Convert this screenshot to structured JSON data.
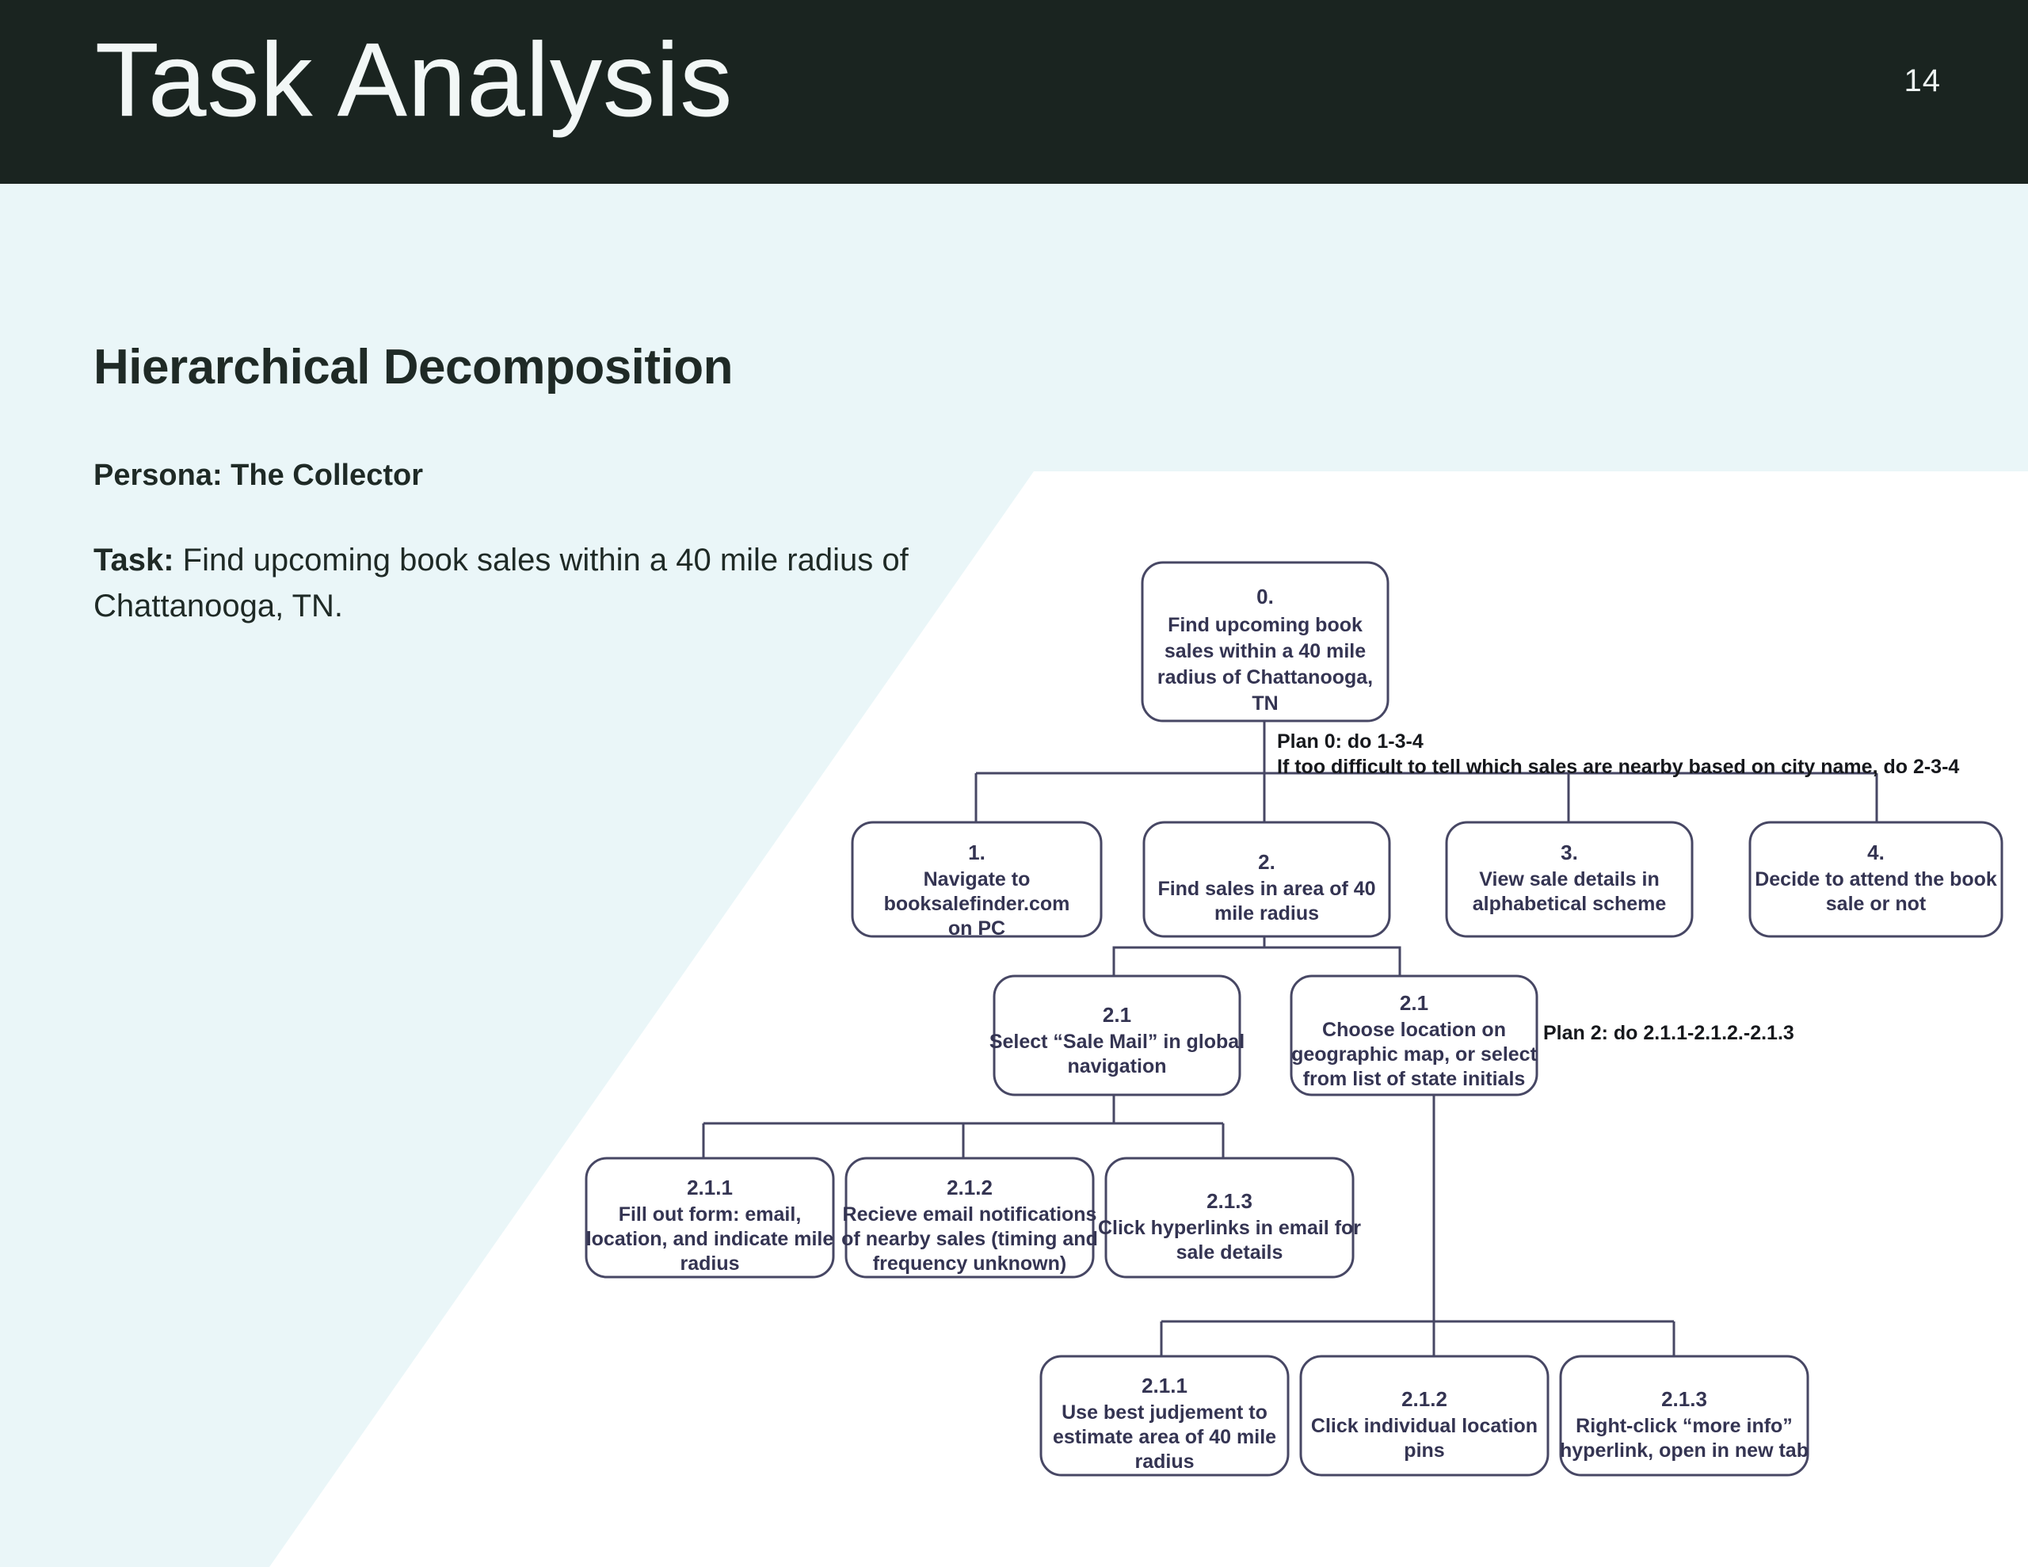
{
  "header": {
    "title": "Task Analysis",
    "page_number": "14",
    "background_color": "#1a2420",
    "text_color": "#f2f7f6"
  },
  "body": {
    "background_color": "#eaf6f8",
    "wedge_color": "#ffffff"
  },
  "content": {
    "heading": "Hierarchical Decomposition",
    "persona_label": "Persona:",
    "persona_value": "The Collector",
    "persona_full": "Persona: The Collector",
    "task_label": "Task:",
    "task_value": "Find upcoming book sales within a 40 mile radius of Chattanooga, TN."
  },
  "diagram": {
    "accent_color": "#474764",
    "node_text_color": "#343452",
    "plan_text_color": "#16181c",
    "nodes": [
      {
        "id": "0",
        "number": "0.",
        "lines": [
          "Find upcoming book",
          "sales within a 40 mile",
          "radius of Chattanooga,",
          "TN"
        ]
      },
      {
        "id": "1",
        "number": "1.",
        "lines": [
          "Navigate to",
          "booksalefinder.com",
          "on PC"
        ]
      },
      {
        "id": "2",
        "number": "2.",
        "lines": [
          "Find sales in area of 40",
          "mile radius"
        ]
      },
      {
        "id": "3",
        "number": "3.",
        "lines": [
          "View sale details in",
          "alphabetical scheme"
        ]
      },
      {
        "id": "4",
        "number": "4.",
        "lines": [
          "Decide to attend the book",
          "sale or not"
        ]
      },
      {
        "id": "2.1a",
        "number": "2.1",
        "lines": [
          "Select “Sale Mail” in global",
          "navigation"
        ]
      },
      {
        "id": "2.1b",
        "number": "2.1",
        "lines": [
          "Choose location on",
          "geographic map, or select",
          "from list of state initials"
        ]
      },
      {
        "id": "2.1.1a",
        "number": "2.1.1",
        "lines": [
          "Fill out form: email,",
          "location, and indicate mile",
          "radius"
        ]
      },
      {
        "id": "2.1.2a",
        "number": "2.1.2",
        "lines": [
          "Recieve email notifications",
          "of nearby sales (timing and",
          "frequency unknown)"
        ]
      },
      {
        "id": "2.1.3a",
        "number": "2.1.3",
        "lines": [
          "Click hyperlinks in email for",
          "sale details"
        ]
      },
      {
        "id": "2.1.1b",
        "number": "2.1.1",
        "lines": [
          "Use best judjement to",
          "estimate area of 40 mile",
          "radius"
        ]
      },
      {
        "id": "2.1.2b",
        "number": "2.1.2",
        "lines": [
          "Click individual location",
          "pins"
        ]
      },
      {
        "id": "2.1.3b",
        "number": "2.1.3",
        "lines": [
          "Right-click “more info”",
          "hyperlink, open in new tab"
        ]
      }
    ],
    "plans": [
      {
        "id": "plan0",
        "lines": [
          "Plan 0: do 1-3-4",
          "If too difficult to tell which sales are nearby based on city name, do 2-3-4"
        ]
      },
      {
        "id": "plan2",
        "lines": [
          "Plan 2: do 2.1.1-2.1.2.-2.1.3"
        ]
      }
    ]
  }
}
